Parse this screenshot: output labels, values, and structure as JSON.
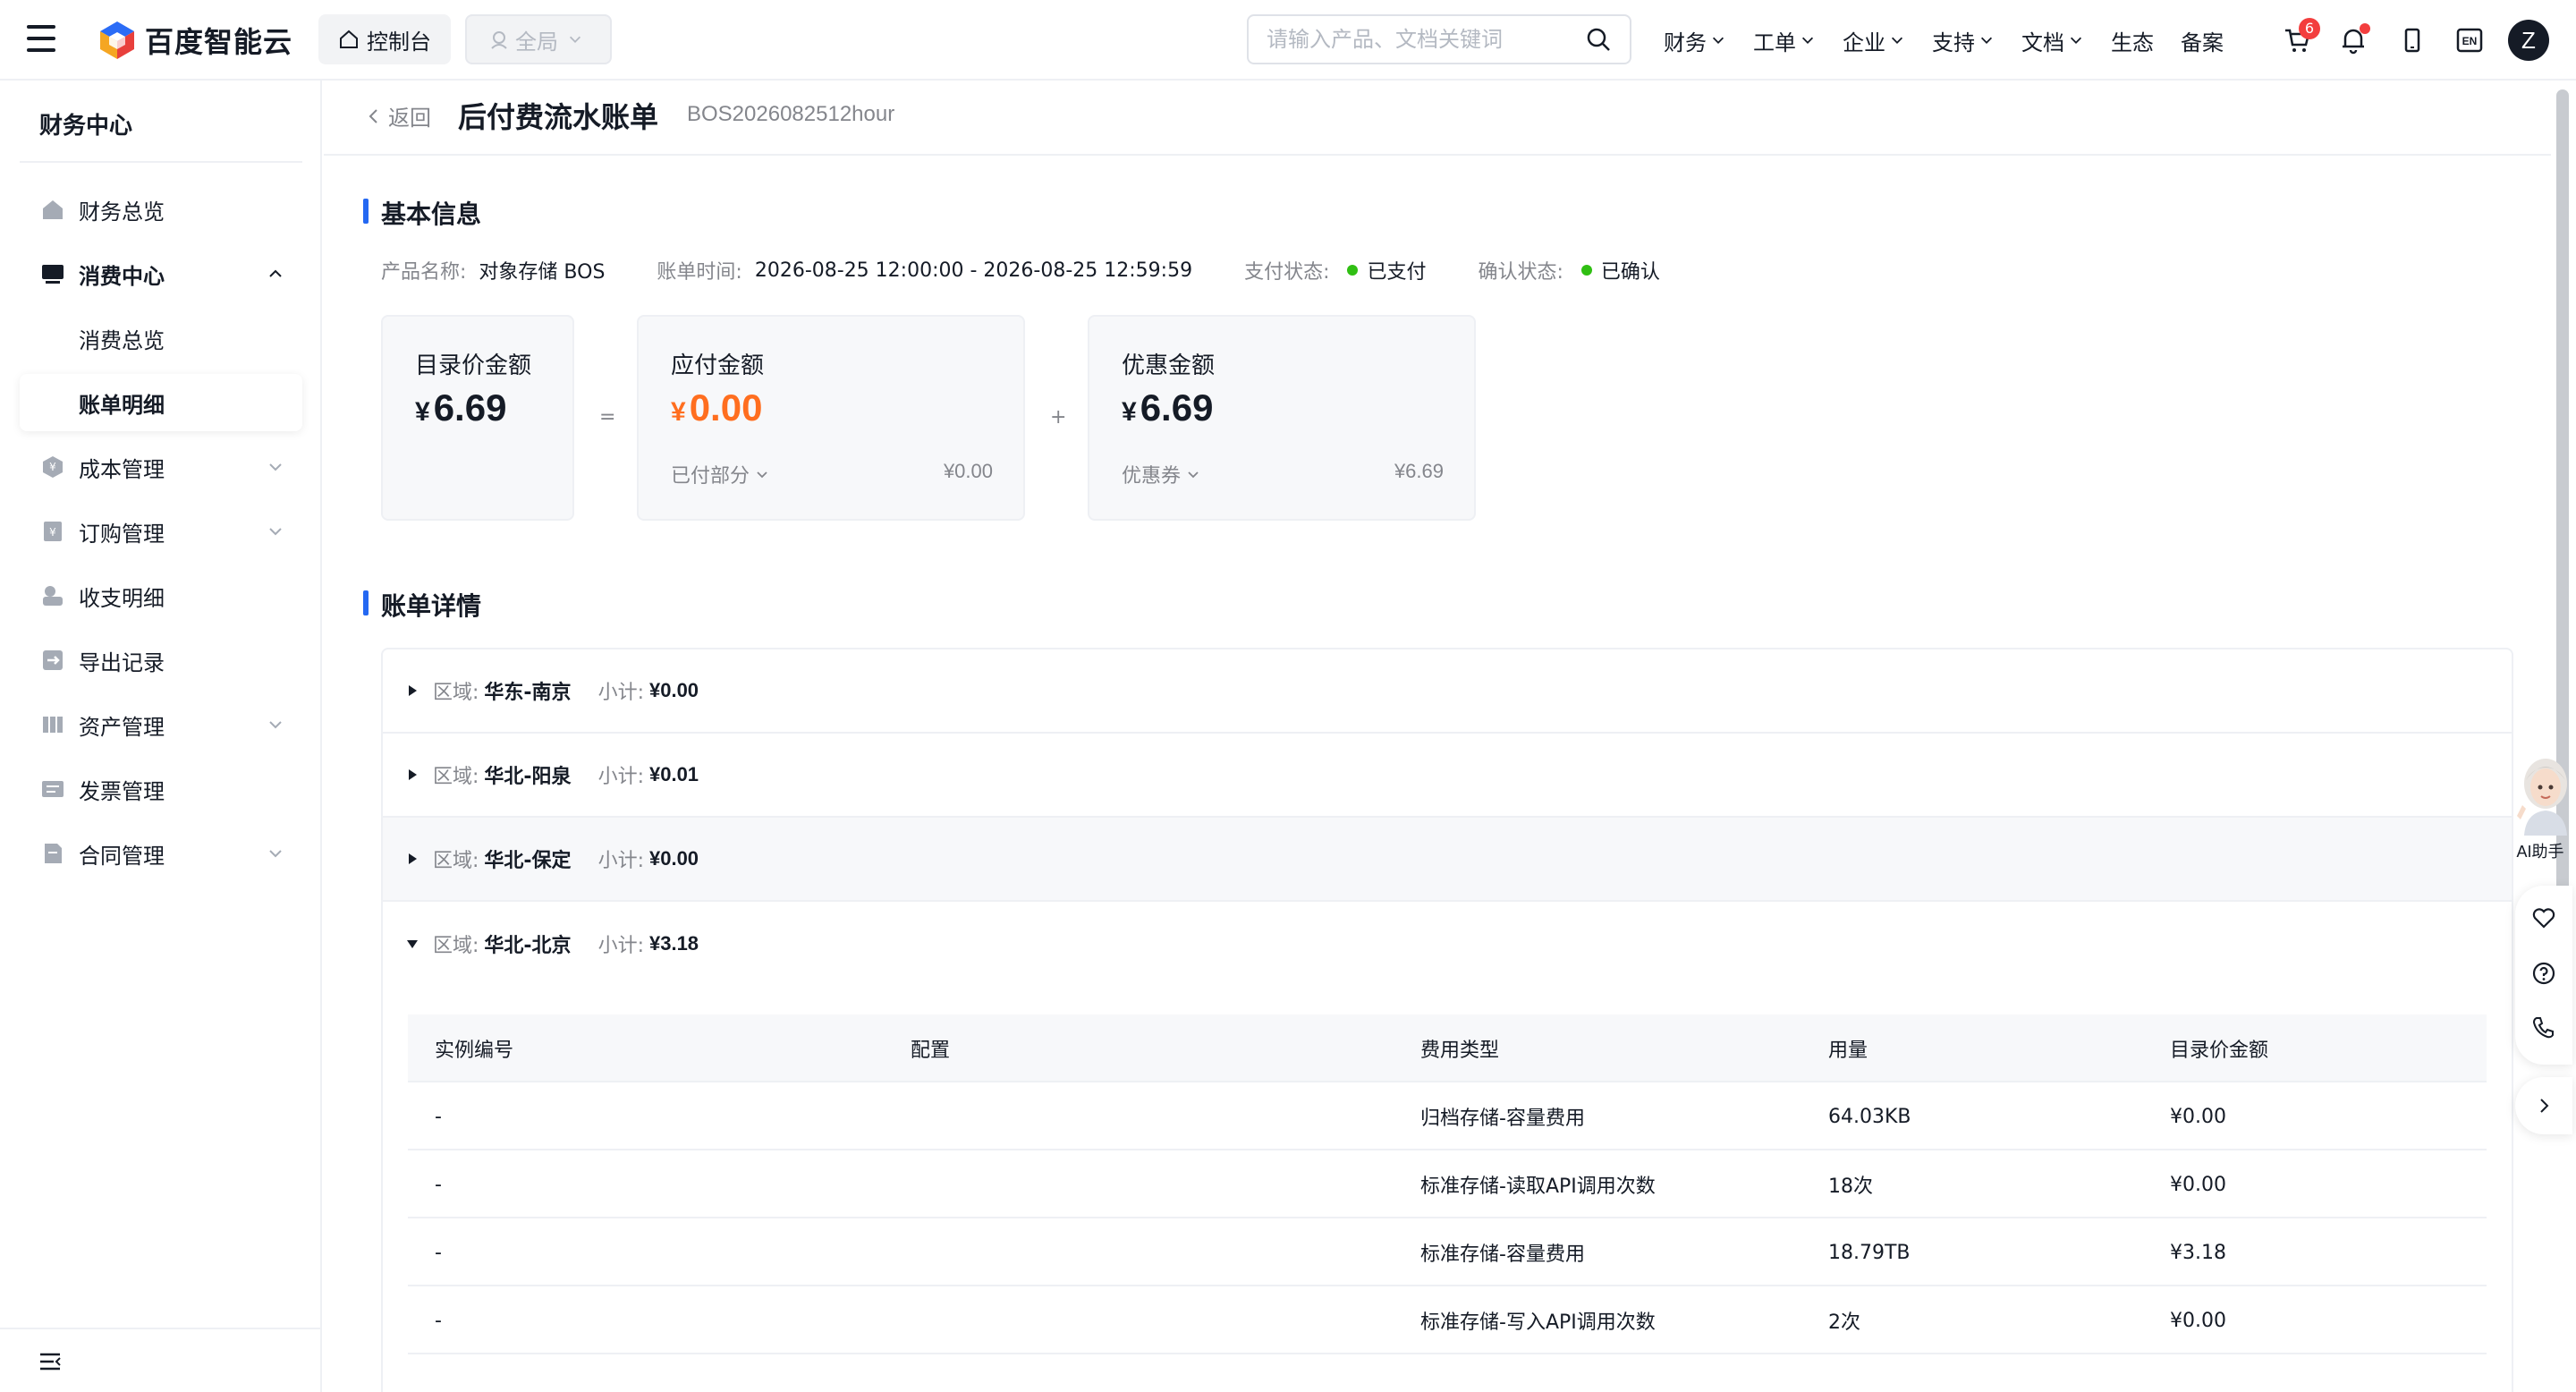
{
  "topbar": {
    "logo_text": "百度智能云",
    "console_label": "控制台",
    "region_label": "全局",
    "search_placeholder": "请输入产品、文档关键词",
    "nav": [
      {
        "label": "财务",
        "has_dropdown": true
      },
      {
        "label": "工单",
        "has_dropdown": true
      },
      {
        "label": "企业",
        "has_dropdown": true
      },
      {
        "label": "支持",
        "has_dropdown": true
      },
      {
        "label": "文档",
        "has_dropdown": true
      },
      {
        "label": "生态",
        "has_dropdown": false
      },
      {
        "label": "备案",
        "has_dropdown": false
      }
    ],
    "cart_badge": "6",
    "lang_label": "EN",
    "avatar_letter": "Z"
  },
  "sidebar": {
    "title": "财务中心",
    "items": [
      {
        "label": "财务总览",
        "icon": "home-icon"
      },
      {
        "label": "消费中心",
        "icon": "monitor-icon",
        "expanded": true
      },
      {
        "label": "消费总览",
        "sub": true
      },
      {
        "label": "账单明细",
        "sub": true,
        "active": true
      },
      {
        "label": "成本管理",
        "icon": "cost-icon",
        "has_arrow": true
      },
      {
        "label": "订购管理",
        "icon": "order-icon",
        "has_arrow": true
      },
      {
        "label": "收支明细",
        "icon": "wallet-icon"
      },
      {
        "label": "导出记录",
        "icon": "export-icon"
      },
      {
        "label": "资产管理",
        "icon": "asset-icon",
        "has_arrow": true
      },
      {
        "label": "发票管理",
        "icon": "invoice-icon"
      },
      {
        "label": "合同管理",
        "icon": "contract-icon",
        "has_arrow": true
      }
    ]
  },
  "page": {
    "back_label": "返回",
    "title": "后付费流水账单",
    "bill_id": "BOS2026082512hour"
  },
  "basic_info": {
    "section_title": "基本信息",
    "product_label": "产品名称:",
    "product_value": "对象存储 BOS",
    "time_label": "账单时间:",
    "time_value": "2026-08-25 12:00:00 - 2026-08-25 12:59:59",
    "pay_label": "支付状态:",
    "pay_value": "已支付",
    "confirm_label": "确认状态:",
    "confirm_value": "已确认",
    "status_color": "#30bf13"
  },
  "cards": {
    "list_price": {
      "title": "目录价金额",
      "amount": "6.69"
    },
    "op_equals": "=",
    "payable": {
      "title": "应付金额",
      "amount": "0.00",
      "sub_label": "已付部分",
      "sub_value": "¥0.00"
    },
    "op_plus": "+",
    "discount": {
      "title": "优惠金额",
      "amount": "6.69",
      "sub_label": "优惠券",
      "sub_value": "¥6.69"
    },
    "currency": "¥",
    "accent_orange": "#ff6e1f"
  },
  "detail": {
    "section_title": "账单详情",
    "region_label": "区域:",
    "subtotal_label": "小计:",
    "regions": [
      {
        "name": "华东-南京",
        "subtotal": "¥0.00",
        "expanded": false
      },
      {
        "name": "华北-阳泉",
        "subtotal": "¥0.01",
        "expanded": false
      },
      {
        "name": "华北-保定",
        "subtotal": "¥0.00",
        "expanded": false
      },
      {
        "name": "华北-北京",
        "subtotal": "¥3.18",
        "expanded": true
      }
    ],
    "columns": [
      "实例编号",
      "配置",
      "费用类型",
      "用量",
      "目录价金额"
    ],
    "rows": [
      [
        "-",
        "",
        "归档存储-容量费用",
        "64.03KB",
        "¥0.00"
      ],
      [
        "-",
        "",
        "标准存储-读取API调用次数",
        "18次",
        "¥0.00"
      ],
      [
        "-",
        "",
        "标准存储-容量费用",
        "18.79TB",
        "¥3.18"
      ],
      [
        "-",
        "",
        "标准存储-写入API调用次数",
        "2次",
        "¥0.00"
      ]
    ]
  },
  "float": {
    "ai_label": "AI助手"
  }
}
